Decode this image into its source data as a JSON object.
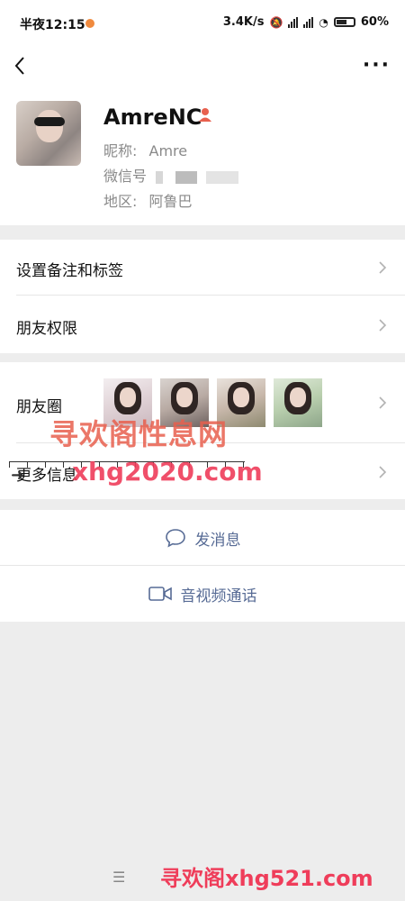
{
  "status": {
    "time": "半夜12:15",
    "speed": "3.4K/s",
    "battery": "60"
  },
  "profile": {
    "nickname": "AmreNC",
    "nickname_label": "昵称:",
    "nickname_value": "Amre",
    "wechat_label": "微信号",
    "region_label": "地区:",
    "region_value": "阿鲁巴"
  },
  "rows": {
    "remark": "设置备注和标签",
    "permission": "朋友权限",
    "moments": "朋友圈",
    "more_info": "更多信息"
  },
  "actions": {
    "message": "发消息",
    "video_call": "音视频通话"
  },
  "watermarks": {
    "w1": "寻欢阁性息网",
    "w2": "xhg2020.com",
    "w3": "寻欢阁xhg521.com"
  },
  "colors": {
    "link": "#576b95",
    "gender": "#e8604e"
  }
}
